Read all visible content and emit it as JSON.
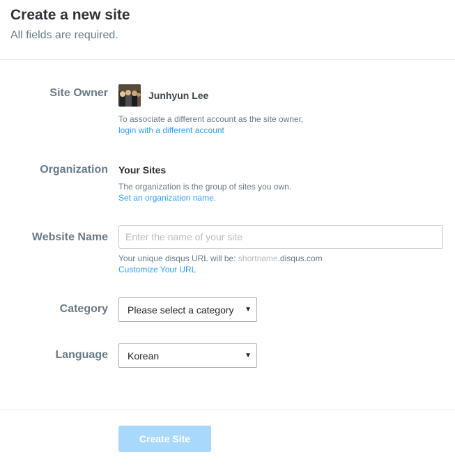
{
  "header": {
    "title": "Create a new site",
    "subtitle": "All fields are required."
  },
  "site_owner": {
    "label": "Site Owner",
    "name": "Junhyun Lee",
    "help": "To associate a different account as the site owner,",
    "link": "login with a different account"
  },
  "organization": {
    "label": "Organization",
    "value": "Your Sites",
    "help": "The organization is the group of sites you own.",
    "link": "Set an organization name."
  },
  "website_name": {
    "label": "Website Name",
    "placeholder": "Enter the name of your site",
    "value": "",
    "help_prefix": "Your unique disqus URL will be: ",
    "help_shortname": "shortname",
    "help_suffix": ".disqus.com",
    "link": "Customize Your URL"
  },
  "category": {
    "label": "Category",
    "selected": "Please select a category"
  },
  "language": {
    "label": "Language",
    "selected": "Korean"
  },
  "actions": {
    "submit": "Create Site"
  },
  "colors": {
    "link": "#2e9fff",
    "label": "#687a86",
    "button_disabled": "#a8d8fb"
  }
}
